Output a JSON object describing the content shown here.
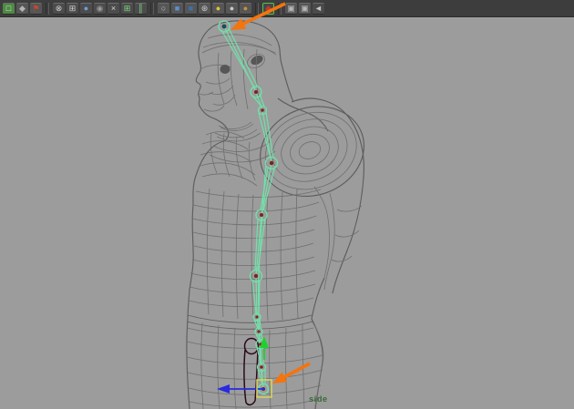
{
  "colors": {
    "toolbar_bg": "#3d3d3d",
    "viewport_bg": "#9c9c9c",
    "wireframe": "#6f6f6f",
    "wireframe_dark": "#5d5d5d",
    "mesh_shadow": "#565656",
    "skeleton": "#70e2a9",
    "joint_dot": "#7a241c",
    "joint_head_dot": "#1d4a5a",
    "annotation_orange": "#f4740e",
    "manip_x_blue": "#2a2ae0",
    "manip_y_green": "#22cf30",
    "control_yellow": "#d8d45e",
    "hip_curve": "#2a0a1a",
    "camera_label_green": "#3b6b3b"
  },
  "toolbar": {
    "icons": [
      {
        "name": "new-scene-icon",
        "glyph": "□",
        "fg": "#e8e8e8",
        "bg": "#4e8a44"
      },
      {
        "name": "open-scene-icon",
        "glyph": "◆",
        "fg": "#b5b5b5",
        "bg": "#565656"
      },
      {
        "name": "save-scene-icon",
        "glyph": "⚑",
        "fg": "#cc4433",
        "bg": "#565656"
      },
      {
        "type": "separator"
      },
      {
        "name": "select-hierarchy-icon",
        "glyph": "⊗",
        "fg": "#cfcfcf",
        "bg": "#4c4c4c"
      },
      {
        "name": "select-object-icon",
        "glyph": "⊞",
        "fg": "#cfcfcf",
        "bg": "#4c4c4c"
      },
      {
        "name": "select-component-icon",
        "glyph": "●",
        "fg": "#6f9fd8",
        "bg": "#4c4c4c"
      },
      {
        "name": "select-mask-icon",
        "glyph": "◉",
        "fg": "#9a9a9a",
        "bg": "#4c4c4c"
      },
      {
        "name": "snap-grid-icon",
        "glyph": "×",
        "fg": "#d8d8d8",
        "bg": "#4c4c4c"
      },
      {
        "name": "snap-curve-icon",
        "glyph": "⊞",
        "fg": "#7fd97f",
        "bg": "#4c4c4c"
      },
      {
        "name": "snap-point-icon",
        "glyph": "║",
        "fg": "#7fd97f",
        "bg": "#4c4c4c"
      },
      {
        "type": "separator"
      },
      {
        "name": "history-sphere-icon",
        "glyph": "○",
        "fg": "#c8c8c8",
        "bg": "#565656"
      },
      {
        "name": "shading-cube-icon",
        "glyph": "■",
        "fg": "#5b8fd0",
        "bg": "#565656"
      },
      {
        "name": "shading-cube-alt-icon",
        "glyph": "■",
        "fg": "#3f6fa8",
        "bg": "#565656"
      },
      {
        "name": "texture-sphere-icon",
        "glyph": "⊛",
        "fg": "#d0d0d0",
        "bg": "#565656"
      },
      {
        "name": "light-yellow-sphere-icon",
        "glyph": "●",
        "fg": "#d9c832",
        "bg": "#565656"
      },
      {
        "name": "light-silver-sphere-icon",
        "glyph": "●",
        "fg": "#c9c9c9",
        "bg": "#565656"
      },
      {
        "name": "light-gold-sphere-icon",
        "glyph": "●",
        "fg": "#c89232",
        "bg": "#565656"
      },
      {
        "type": "separator"
      },
      {
        "name": "snap-active-icon",
        "glyph": "◆",
        "fg": "#c23a2a",
        "bg": "#474747",
        "border": "#55c34f"
      },
      {
        "type": "separator"
      },
      {
        "name": "render-view-icon",
        "glyph": "▣",
        "fg": "#b8b8b8",
        "bg": "#565656"
      },
      {
        "name": "ipr-render-icon",
        "glyph": "▣",
        "fg": "#b8b8b8",
        "bg": "#565656"
      },
      {
        "name": "shelf-collapse-icon",
        "glyph": "◄",
        "fg": "#c8c8c8",
        "bg": "#4a4a4a"
      }
    ]
  },
  "viewport": {
    "camera_label": "side"
  }
}
